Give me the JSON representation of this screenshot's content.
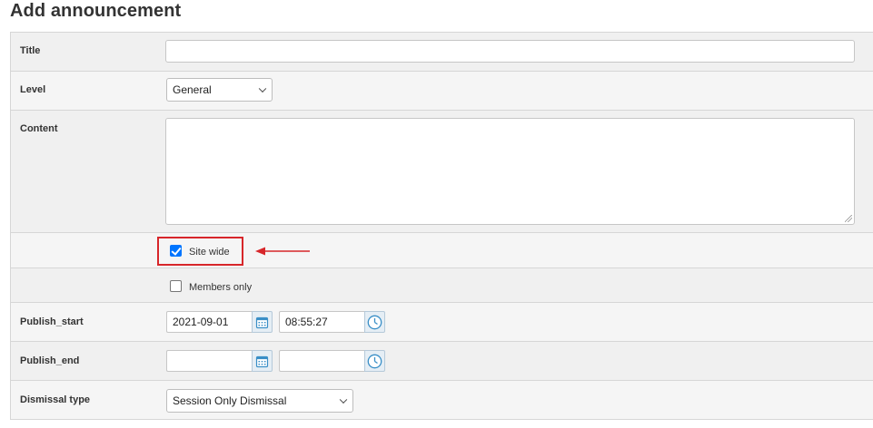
{
  "page": {
    "title": "Add announcement"
  },
  "form": {
    "title": {
      "label": "Title",
      "value": ""
    },
    "level": {
      "label": "Level",
      "value": "General"
    },
    "content": {
      "label": "Content",
      "value": ""
    },
    "site_wide": {
      "label": "Site wide",
      "checked": true
    },
    "members_only": {
      "label": "Members only",
      "checked": false
    },
    "publish_start": {
      "label": "Publish_start",
      "date": "2021-09-01",
      "time": "08:55:27"
    },
    "publish_end": {
      "label": "Publish_end",
      "date": "",
      "time": ""
    },
    "dismissal_type": {
      "label": "Dismissal type",
      "value": "Session Only Dismissal"
    }
  },
  "icons": {
    "calendar": "calendar-icon",
    "clock": "clock-icon",
    "chevron": "chevron-down-icon"
  },
  "colors": {
    "accent_checkbox": "#0075ff",
    "highlight_red": "#d7262a",
    "icon_blue": "#3a8fc7"
  }
}
